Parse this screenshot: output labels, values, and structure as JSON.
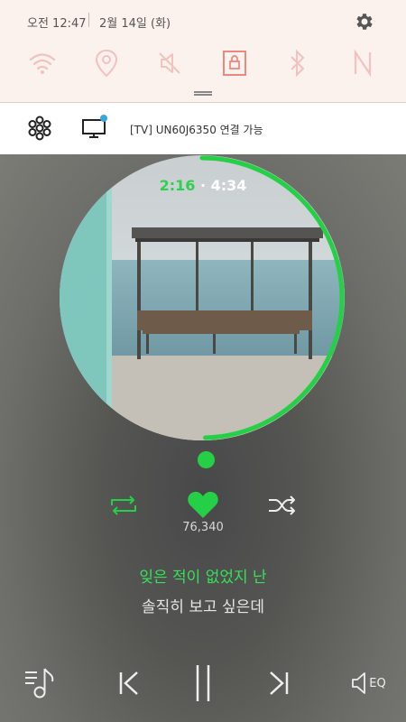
{
  "status": {
    "time": "오전 12:47",
    "date": "2월 14일 (화)"
  },
  "quick_settings": [
    "wifi-icon",
    "location-icon",
    "mute-icon",
    "lock-icon",
    "bluetooth-icon",
    "nfc-icon"
  ],
  "device_bar": {
    "tv_label": "[TV] UN60J6350 연결 가능"
  },
  "player": {
    "elapsed": "2:16",
    "separator": "·",
    "duration": "4:34",
    "progress_fraction": 0.4964,
    "likes": "76,340",
    "lyric_current": "잊은 적이 없었지 난",
    "lyric_next": "솔직히 보고 싶은데",
    "eq_label": "EQ"
  },
  "colors": {
    "accent": "#26d046",
    "shade_bg": "#fbf1ed",
    "tv_dot": "#3aa7e0"
  }
}
